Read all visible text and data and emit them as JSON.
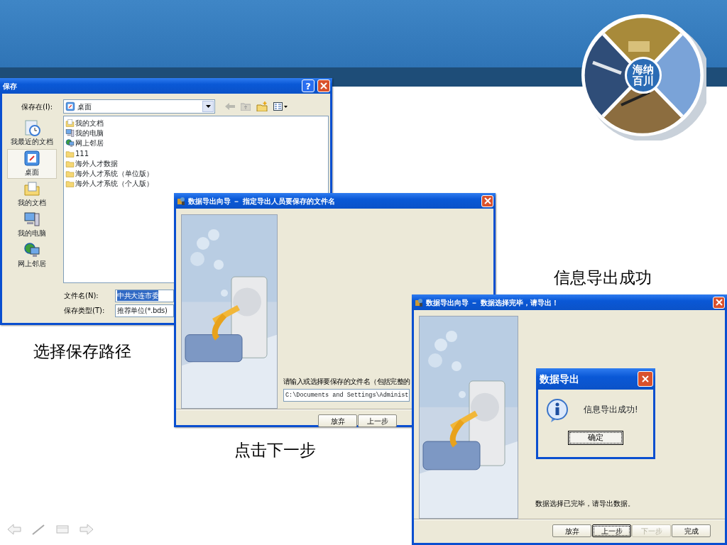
{
  "logo": {
    "lines": [
      "海纳",
      "百川"
    ]
  },
  "save_dialog": {
    "title": "保存",
    "help_glyph": "?",
    "look_in_label": "保存在(I):",
    "look_in": "桌面",
    "places": [
      {
        "label": "我最近的文档",
        "kind": "recent",
        "selected": false
      },
      {
        "label": "桌面",
        "kind": "desktop",
        "selected": true
      },
      {
        "label": "我的文档",
        "kind": "documents",
        "selected": false
      },
      {
        "label": "我的电脑",
        "kind": "computer",
        "selected": false
      },
      {
        "label": "网上邻居",
        "kind": "network",
        "selected": false
      }
    ],
    "files": [
      {
        "name": "我的文档",
        "kind": "documents"
      },
      {
        "name": "我的电脑",
        "kind": "computer"
      },
      {
        "name": "网上邻居",
        "kind": "network"
      },
      {
        "name": "111",
        "kind": "folder"
      },
      {
        "name": "海外人才数据",
        "kind": "folder"
      },
      {
        "name": "海外人才系统（单位版）",
        "kind": "folder"
      },
      {
        "name": "海外人才系统（个人版）",
        "kind": "folder"
      }
    ],
    "filename_label": "文件名(N):",
    "filename": "中共大连市委",
    "filename_selected": true,
    "filetype_label": "保存类型(T):",
    "filetype": "推荐单位(*.bds)",
    "caption": "选择保存路径"
  },
  "wizard_filename": {
    "title": "数据导出向导 － 指定导出人员要保存的文件名",
    "prompt": "请输入或选择要保存的文件名（包括完整的",
    "path": "C:\\Documents and Settings\\Administ",
    "buttons": [
      {
        "label": "放弃",
        "disabled": false,
        "focused": false
      },
      {
        "label": "上一步",
        "disabled": false,
        "focused": false
      }
    ],
    "caption": "点击下一步"
  },
  "wizard_finish": {
    "title": "数据导出向导 － 数据选择完毕，请导出！",
    "message": "数据选择已完毕，请导出数据。",
    "buttons": [
      {
        "label": "放弃",
        "disabled": false,
        "focused": false
      },
      {
        "label": "上一步",
        "disabled": false,
        "focused": true
      },
      {
        "label": "下一步",
        "disabled": true,
        "focused": false
      },
      {
        "label": "完成",
        "disabled": false,
        "focused": false
      }
    ],
    "message_box": {
      "title": "数据导出",
      "text": "信息导出成功!",
      "ok": "确定",
      "ok_focused": true
    },
    "caption": "信息导出成功"
  }
}
